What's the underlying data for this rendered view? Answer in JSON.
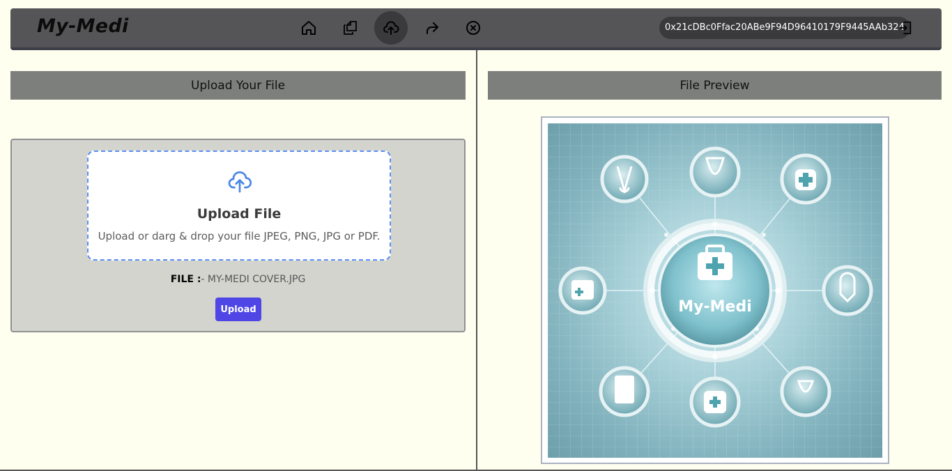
{
  "app": {
    "logo": "My-Medi"
  },
  "nav": {
    "items": [
      {
        "name": "home",
        "icon": "home-icon",
        "active": false
      },
      {
        "name": "files",
        "icon": "copy-files-icon",
        "active": false
      },
      {
        "name": "upload",
        "icon": "cloud-upload-icon",
        "active": true
      },
      {
        "name": "share",
        "icon": "share-icon",
        "active": false
      },
      {
        "name": "revoke",
        "icon": "close-circle-icon",
        "active": false
      }
    ],
    "wallet_address": "0x21cDBc0Ffac20ABe9F94D96410179F9445AAb324",
    "logout_icon": "logout-icon"
  },
  "upload_section": {
    "header": "Upload Your File",
    "dropzone": {
      "icon": "cloud-upload-icon",
      "title": "Upload File",
      "subtitle": "Upload or darg & drop your file JPEG, PNG, JPG or PDF."
    },
    "file_label": "FILE :",
    "file_value": "- MY-MEDI COVER.JPG",
    "upload_button": "Upload"
  },
  "preview_section": {
    "header": "File Preview",
    "image_text": "My-Medi"
  },
  "colors": {
    "background": "#fffff0",
    "navbar": "#555557",
    "accent": "#4f46e5",
    "dropzone_border": "#5b8ff0"
  }
}
